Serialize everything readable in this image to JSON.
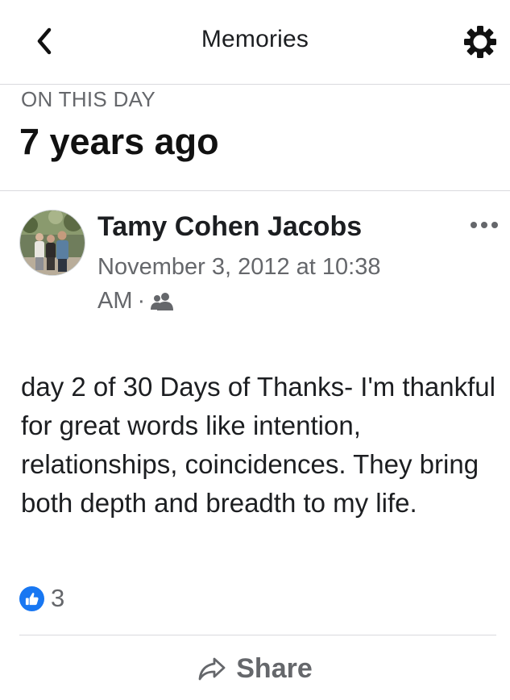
{
  "header": {
    "title": "Memories",
    "back_icon": "chevron-left-icon",
    "settings_icon": "gear-icon"
  },
  "memory": {
    "eyebrow": "ON THIS DAY",
    "years_ago": "7 years ago"
  },
  "post": {
    "author": "Tamy Cohen Jacobs",
    "timestamp": "November 3, 2012 at 10:38 AM",
    "separator": "·",
    "audience_icon": "friends-icon",
    "more_icon": "more-options-icon",
    "text": "day 2 of 30 Days of Thanks- I'm thankful for great words like intention, relationships, coincidences. They bring both depth and breadth to my life.",
    "reactions": {
      "icon": "thumbs-up-icon",
      "count": "3",
      "color": "#1877f2"
    },
    "share": {
      "label": "Share",
      "icon": "share-arrow-icon"
    }
  },
  "colors": {
    "primary_text": "#1c1e21",
    "secondary_text": "#65676b",
    "divider": "#d9d9de",
    "accent": "#1877f2"
  }
}
